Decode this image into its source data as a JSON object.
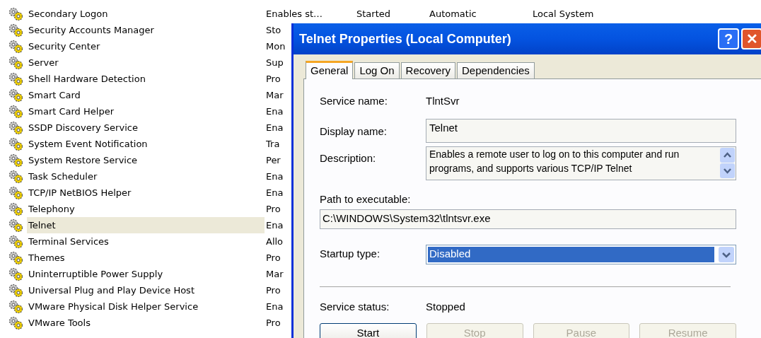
{
  "services": [
    {
      "name": "Secondary Logon",
      "description": "Enables st…",
      "status": "Started",
      "startup_type": "Automatic",
      "log_on_as": "Local System",
      "selected": false
    },
    {
      "name": "Security Accounts Manager",
      "description": "Sto",
      "selected": false
    },
    {
      "name": "Security Center",
      "description": "Mon",
      "selected": false
    },
    {
      "name": "Server",
      "description": "Sup",
      "selected": false
    },
    {
      "name": "Shell Hardware Detection",
      "description": "Pro",
      "selected": false
    },
    {
      "name": "Smart Card",
      "description": "Mar",
      "selected": false
    },
    {
      "name": "Smart Card Helper",
      "description": "Ena",
      "selected": false
    },
    {
      "name": "SSDP Discovery Service",
      "description": "Ena",
      "selected": false
    },
    {
      "name": "System Event Notification",
      "description": "Tra",
      "selected": false
    },
    {
      "name": "System Restore Service",
      "description": "Per",
      "selected": false
    },
    {
      "name": "Task Scheduler",
      "description": "Ena",
      "selected": false
    },
    {
      "name": "TCP/IP NetBIOS Helper",
      "description": "Ena",
      "selected": false
    },
    {
      "name": "Telephony",
      "description": "Pro",
      "selected": false
    },
    {
      "name": "Telnet",
      "description": "Ena",
      "selected": true
    },
    {
      "name": "Terminal Services",
      "description": "Allo",
      "selected": false
    },
    {
      "name": "Themes",
      "description": "Pro",
      "selected": false
    },
    {
      "name": "Uninterruptible Power Supply",
      "description": "Mar",
      "selected": false
    },
    {
      "name": "Universal Plug and Play Device Host",
      "description": "Pro",
      "selected": false
    },
    {
      "name": "VMware Physical Disk Helper Service",
      "description": "Ena",
      "selected": false
    },
    {
      "name": "VMware Tools",
      "description": "Pro",
      "selected": false
    }
  ],
  "dialog": {
    "title": "Telnet Properties (Local Computer)",
    "title_buttons": [
      "?",
      "✕"
    ],
    "tabs": [
      {
        "label": "General",
        "selected": true
      },
      {
        "label": "Log On",
        "selected": false
      },
      {
        "label": "Recovery",
        "selected": false
      },
      {
        "label": "Dependencies",
        "selected": false
      }
    ],
    "service_name": {
      "label": "Service name:",
      "value": "TlntSvr"
    },
    "display_name": {
      "label": "Display name:",
      "value": "Telnet"
    },
    "description": {
      "label": "Description:",
      "value": "Enables a remote user to log on to this computer and run programs, and supports various TCP/IP Telnet"
    },
    "path": {
      "label": "Path to executable:",
      "value": "C:\\WINDOWS\\System32\\tlntsvr.exe"
    },
    "startup_type": {
      "label": "Startup type:",
      "value": "Disabled"
    },
    "service_status": {
      "label": "Service status:",
      "value": "Stopped"
    },
    "buttons": [
      {
        "label": "Start",
        "disabled": false
      },
      {
        "label": "Stop",
        "disabled": true
      },
      {
        "label": "Pause",
        "disabled": true
      },
      {
        "label": "Resume",
        "disabled": true
      }
    ]
  }
}
